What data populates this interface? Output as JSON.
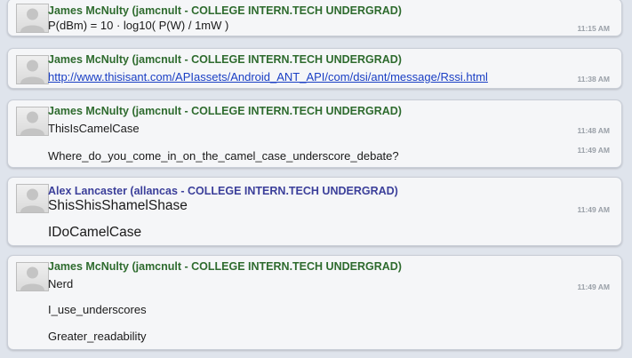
{
  "colors": {
    "james": "#2e6b2e",
    "alex": "#3b3f9a",
    "link": "#1a3fc4",
    "time": "#9aa0a8"
  },
  "messages": [
    {
      "author": "James McNulty (jamcnult - COLLEGE INTERN.TECH UNDERGRAD)",
      "lines": [
        {
          "text": "P(dBm) = 10 · log10( P(W) / 1mW )",
          "time": "11:15 AM"
        }
      ]
    },
    {
      "author": "James McNulty (jamcnult - COLLEGE INTERN.TECH UNDERGRAD)",
      "lines": [
        {
          "text": "http://www.thisisant.com/APIassets/Android_ANT_API/com/dsi/ant/message/Rssi.html",
          "time": "11:38 AM"
        }
      ]
    },
    {
      "author": "James McNulty (jamcnult - COLLEGE INTERN.TECH UNDERGRAD)",
      "lines": [
        {
          "text": "ThisIsCamelCase",
          "time": "11:48 AM"
        },
        {
          "text": "Where_do_you_come_in_on_the_camel_case_underscore_debate?",
          "time": "11:49 AM"
        }
      ]
    },
    {
      "author": "Alex Lancaster (allancas - COLLEGE INTERN.TECH UNDERGRAD)",
      "lines": [
        {
          "text": "ShisShisShamelShase",
          "time": "11:49 AM"
        },
        {
          "text": "IDoCamelCase",
          "time": ""
        }
      ]
    },
    {
      "author": "James McNulty (jamcnult - COLLEGE INTERN.TECH UNDERGRAD)",
      "lines": [
        {
          "text": "Nerd",
          "time": "11:49 AM"
        },
        {
          "text": "I_use_underscores",
          "time": ""
        },
        {
          "text": "Greater_readability",
          "time": ""
        }
      ]
    }
  ]
}
